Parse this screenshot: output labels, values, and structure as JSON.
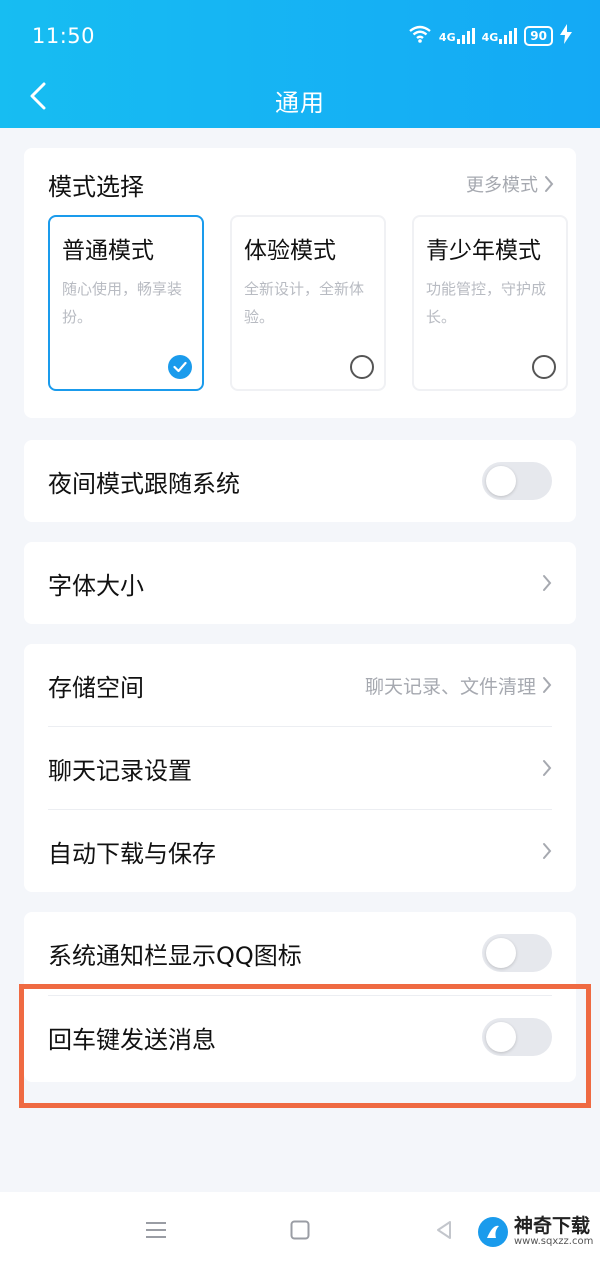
{
  "status_bar": {
    "time": "11:50",
    "network_1": "4G",
    "network_2": "4G",
    "battery": "90"
  },
  "nav": {
    "title": "通用"
  },
  "mode_section": {
    "title": "模式选择",
    "more_label": "更多模式",
    "options": [
      {
        "name": "普通模式",
        "description": "随心使用，畅享装扮。",
        "selected": true
      },
      {
        "name": "体验模式",
        "description": "全新设计，全新体验。",
        "selected": false
      },
      {
        "name": "青少年模式",
        "description": "功能管控，守护成长。",
        "selected": false
      }
    ]
  },
  "night_mode": {
    "label": "夜间模式跟随系统",
    "enabled": false
  },
  "font_size": {
    "label": "字体大小"
  },
  "storage_group": {
    "items": [
      {
        "label": "存储空间",
        "detail": "聊天记录、文件清理"
      },
      {
        "label": "聊天记录设置",
        "detail": ""
      },
      {
        "label": "自动下载与保存",
        "detail": ""
      }
    ]
  },
  "toggle_group": {
    "items": [
      {
        "label": "系统通知栏显示QQ图标",
        "enabled": false
      },
      {
        "label": "回车键发送消息",
        "enabled": false
      }
    ]
  },
  "watermark": {
    "name": "神奇下载",
    "url": "www.sqxzz.com"
  },
  "colors": {
    "accent": "#1a9bec",
    "header": "#17bdf2",
    "highlight_border": "#ef6a42"
  }
}
